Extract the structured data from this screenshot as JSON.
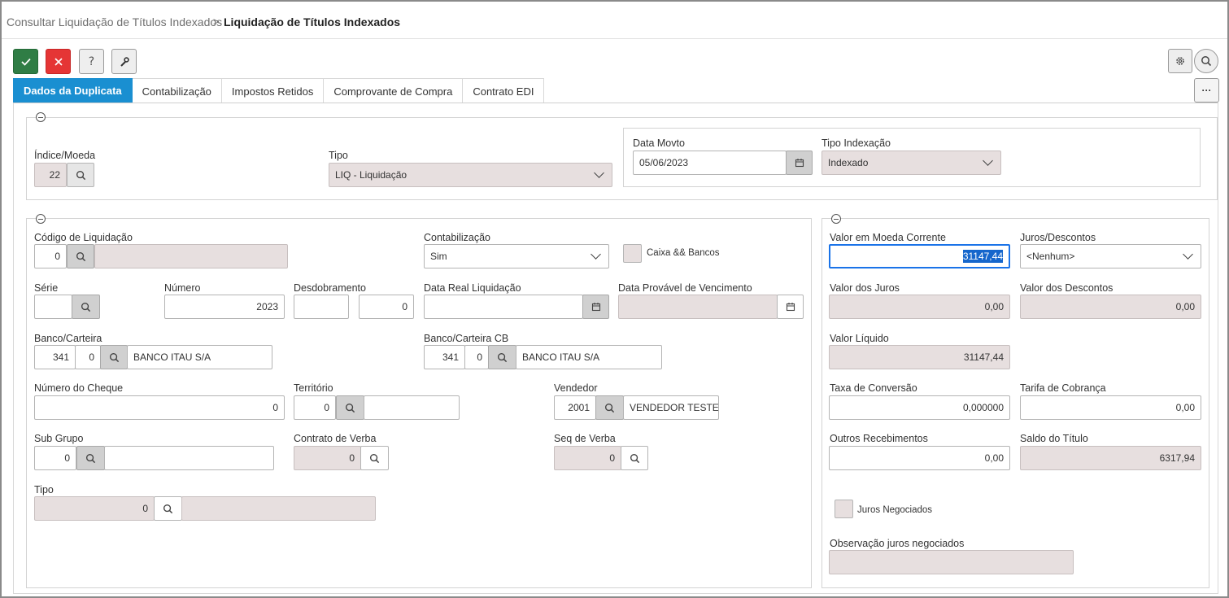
{
  "breadcrumb": {
    "parent": "Consultar Liquidação de Títulos Indexados",
    "separator": ">",
    "current": "Liquidação de Títulos Indexados"
  },
  "tabs": [
    {
      "label": "Dados da Duplicata",
      "active": true
    },
    {
      "label": "Contabilização",
      "active": false
    },
    {
      "label": "Impostos Retidos",
      "active": false
    },
    {
      "label": "Comprovante de Compra",
      "active": false
    },
    {
      "label": "Contrato EDI",
      "active": false
    }
  ],
  "more_label": "···",
  "colors": {
    "accent": "#1a8fd1",
    "ok": "#2f7d45",
    "cancel": "#e53535",
    "readonly": "#e7dfdf"
  },
  "header_panel": {
    "indice_label": "Índice/Moeda",
    "indice_value": "22",
    "tipo_label": "Tipo",
    "tipo_value": "LIQ - Liquidação",
    "data_movto_label": "Data Movto",
    "data_movto_value": "05/06/2023",
    "tipo_indexacao_label": "Tipo Indexação",
    "tipo_indexacao_value": "Indexado"
  },
  "left_panel": {
    "codigo_label": "Código de Liquidação",
    "codigo_value": "0",
    "codigo_desc": "",
    "contabilizacao_label": "Contabilização",
    "contabilizacao_value": "Sim",
    "caixa_label": "Caixa && Bancos",
    "serie_label": "Série",
    "serie_value": "",
    "numero_label": "Número",
    "numero_value": "2023",
    "desdobramento_label": "Desdobramento",
    "desdobramento_value1": "",
    "desdobramento_value2": "0",
    "data_real_label": "Data Real Liquidação",
    "data_real_value": "",
    "data_provavel_label": "Data Provável de Vencimento",
    "data_provavel_value": "",
    "banco_label": "Banco/Carteira",
    "banco_code": "341",
    "banco_carteira": "0",
    "banco_name": "BANCO ITAU S/A",
    "banco_cb_label": "Banco/Carteira CB",
    "banco_cb_code": "341",
    "banco_cb_carteira": "0",
    "banco_cb_name": "BANCO ITAU S/A",
    "cheque_label": "Número do Cheque",
    "cheque_value": "0",
    "territorio_label": "Território",
    "territorio_value": "0",
    "territorio_desc": "",
    "vendedor_label": "Vendedor",
    "vendedor_code": "2001",
    "vendedor_name": "VENDEDOR TESTE",
    "subgrupo_label": "Sub Grupo",
    "subgrupo_value": "0",
    "subgrupo_desc": "",
    "contrato_label": "Contrato de Verba",
    "contrato_value": "0",
    "seq_label": "Seq de Verba",
    "seq_value": "0",
    "tipo_label": "Tipo",
    "tipo_value": "0",
    "tipo_desc": ""
  },
  "right_panel": {
    "valor_moeda_label": "Valor em Moeda Corrente",
    "valor_moeda_value": "31147,44",
    "juros_desc_label": "Juros/Descontos",
    "juros_desc_value": "<Nenhum>",
    "valor_juros_label": "Valor dos Juros",
    "valor_juros_value": "0,00",
    "valor_descontos_label": "Valor dos Descontos",
    "valor_descontos_value": "0,00",
    "valor_liquido_label": "Valor Líquido",
    "valor_liquido_value": "31147,44",
    "taxa_label": "Taxa de Conversão",
    "taxa_value": "0,000000",
    "tarifa_label": "Tarifa de Cobrança",
    "tarifa_value": "0,00",
    "outros_label": "Outros Recebimentos",
    "outros_value": "0,00",
    "saldo_label": "Saldo do Título",
    "saldo_value": "6317,94",
    "juros_neg_label": "Juros Negociados",
    "obs_label": "Observação juros negociados",
    "obs_value": ""
  }
}
